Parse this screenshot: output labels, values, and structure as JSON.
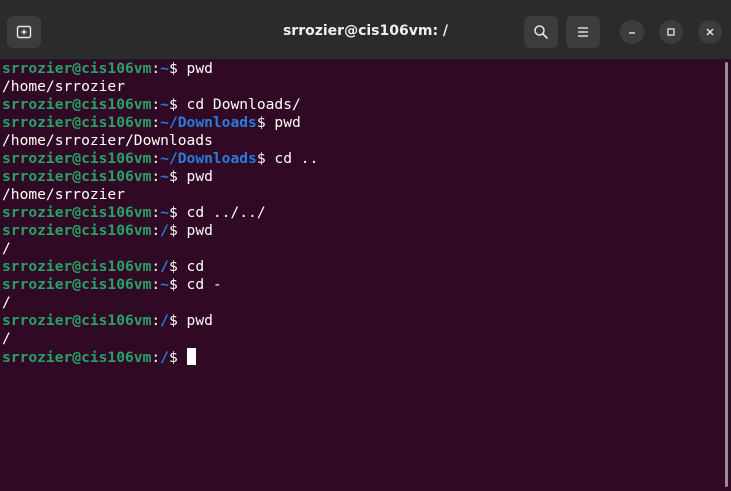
{
  "window": {
    "title": "srrozier@cis106vm: /"
  },
  "toolbar": {
    "new_tab_icon": "new-tab-icon",
    "search_icon": "search-icon",
    "menu_icon": "hamburger-menu-icon",
    "minimize_icon": "minimize-icon",
    "maximize_icon": "maximize-icon",
    "close_icon": "close-icon"
  },
  "colors": {
    "titlebar": "#2b2b2b",
    "background": "#300a24",
    "user_host": "#26a269",
    "path": "#2a7bde",
    "text": "#ffffff"
  },
  "terminal": {
    "lines": [
      {
        "type": "prompt",
        "user": "srrozier@cis106vm",
        "sep": ":",
        "path": "~",
        "dollar": "$ ",
        "cmd": "pwd"
      },
      {
        "type": "output",
        "text": "/home/srrozier"
      },
      {
        "type": "prompt",
        "user": "srrozier@cis106vm",
        "sep": ":",
        "path": "~",
        "dollar": "$ ",
        "cmd": "cd Downloads/"
      },
      {
        "type": "prompt",
        "user": "srrozier@cis106vm",
        "sep": ":",
        "path": "~/Downloads",
        "dollar": "$ ",
        "cmd": "pwd"
      },
      {
        "type": "output",
        "text": "/home/srrozier/Downloads"
      },
      {
        "type": "prompt",
        "user": "srrozier@cis106vm",
        "sep": ":",
        "path": "~/Downloads",
        "dollar": "$ ",
        "cmd": "cd .."
      },
      {
        "type": "prompt",
        "user": "srrozier@cis106vm",
        "sep": ":",
        "path": "~",
        "dollar": "$ ",
        "cmd": "pwd"
      },
      {
        "type": "output",
        "text": "/home/srrozier"
      },
      {
        "type": "prompt",
        "user": "srrozier@cis106vm",
        "sep": ":",
        "path": "~",
        "dollar": "$ ",
        "cmd": "cd ../../"
      },
      {
        "type": "prompt",
        "user": "srrozier@cis106vm",
        "sep": ":",
        "path": "/",
        "dollar": "$ ",
        "cmd": "pwd"
      },
      {
        "type": "output",
        "text": "/"
      },
      {
        "type": "prompt",
        "user": "srrozier@cis106vm",
        "sep": ":",
        "path": "/",
        "dollar": "$ ",
        "cmd": "cd"
      },
      {
        "type": "prompt",
        "user": "srrozier@cis106vm",
        "sep": ":",
        "path": "~",
        "dollar": "$ ",
        "cmd": "cd -"
      },
      {
        "type": "output",
        "text": "/"
      },
      {
        "type": "prompt",
        "user": "srrozier@cis106vm",
        "sep": ":",
        "path": "/",
        "dollar": "$ ",
        "cmd": "pwd"
      },
      {
        "type": "output",
        "text": "/"
      },
      {
        "type": "prompt",
        "user": "srrozier@cis106vm",
        "sep": ":",
        "path": "/",
        "dollar": "$ ",
        "cmd": "",
        "cursor": true
      }
    ]
  }
}
